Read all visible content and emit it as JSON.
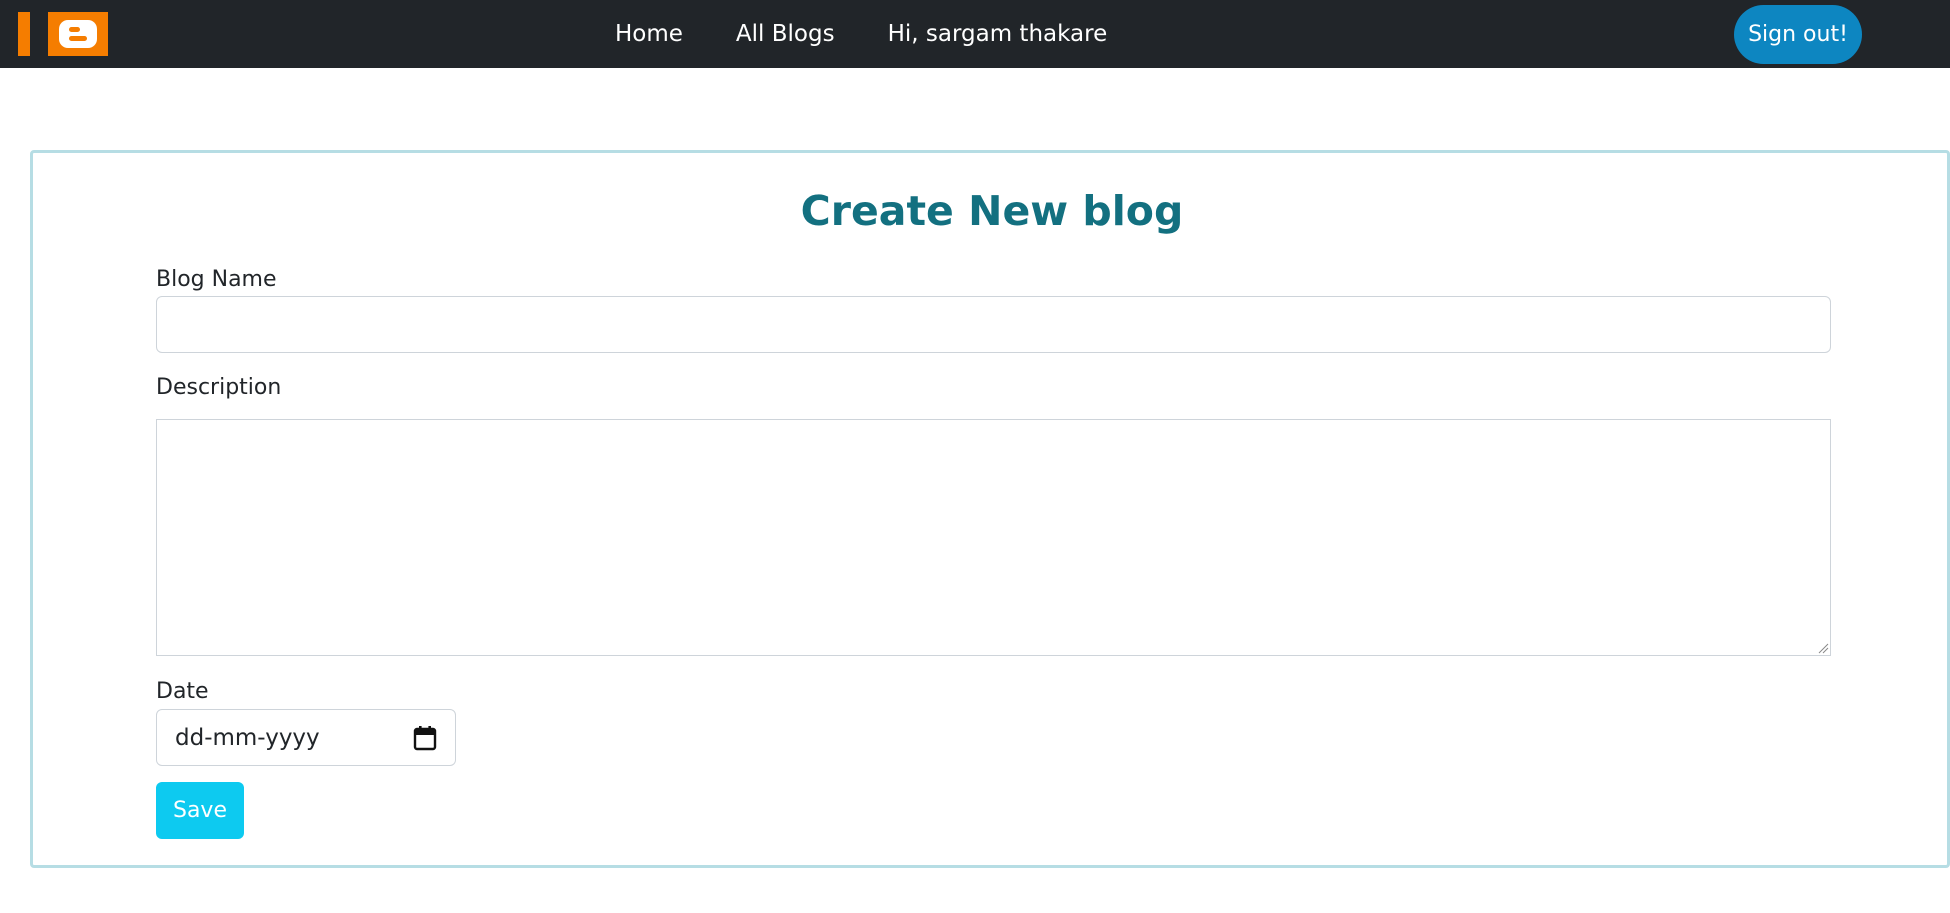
{
  "navbar": {
    "logo_icon": "blogger-logo-icon",
    "brand_color": "#f57d00",
    "links": [
      {
        "label": "Home"
      },
      {
        "label": "All Blogs"
      }
    ],
    "greeting": "Hi, sargam thakare",
    "signout_label": "Sign out!"
  },
  "form": {
    "title": "Create New blog",
    "blog_name": {
      "label": "Blog Name",
      "value": "",
      "placeholder": ""
    },
    "description": {
      "label": "Description",
      "value": "",
      "placeholder": ""
    },
    "date": {
      "label": "Date",
      "placeholder": "dd-mm-yyyy",
      "icon": "calendar-icon"
    },
    "save_label": "Save"
  },
  "colors": {
    "navbar_bg": "#212529",
    "title": "#137080",
    "card_border": "#b6dde4",
    "signout_bg": "#0d86c1",
    "save_bg": "#0dcaf0"
  }
}
